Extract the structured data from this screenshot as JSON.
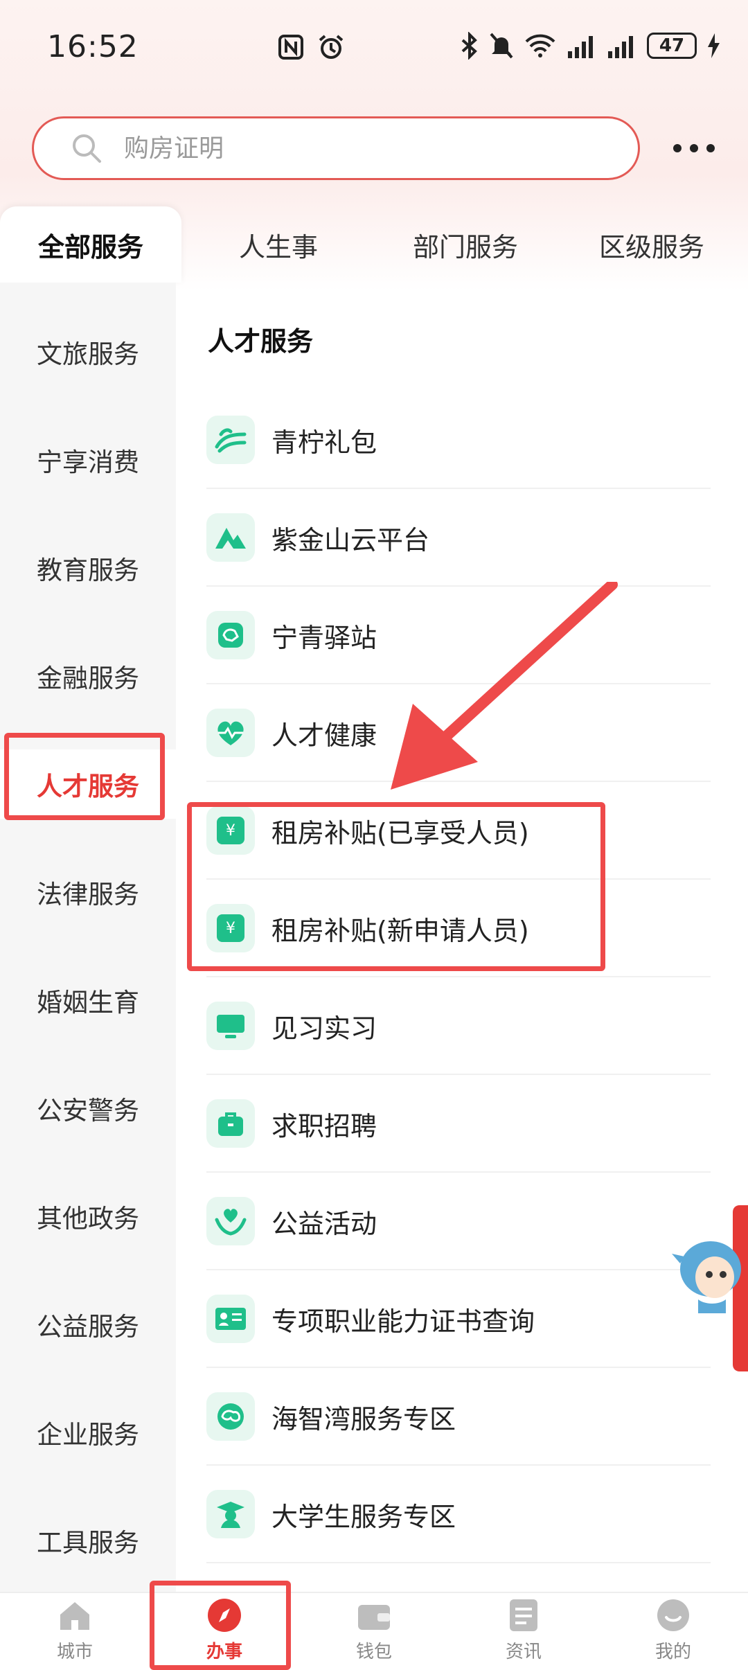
{
  "status_bar": {
    "time": "16:52",
    "battery": "47"
  },
  "search": {
    "placeholder": "购房证明"
  },
  "tabs": [
    {
      "label": "全部服务"
    },
    {
      "label": "人生事"
    },
    {
      "label": "部门服务"
    },
    {
      "label": "区级服务"
    }
  ],
  "side_nav": [
    {
      "label": "文旅服务"
    },
    {
      "label": "宁享消费"
    },
    {
      "label": "教育服务"
    },
    {
      "label": "金融服务"
    },
    {
      "label": "人才服务"
    },
    {
      "label": "法律服务"
    },
    {
      "label": "婚姻生育"
    },
    {
      "label": "公安警务"
    },
    {
      "label": "其他政务"
    },
    {
      "label": "公益服务"
    },
    {
      "label": "企业服务"
    },
    {
      "label": "工具服务"
    }
  ],
  "section": {
    "title": "人才服务"
  },
  "services": [
    {
      "label": "青柠礼包",
      "icon": "lime-gift-icon"
    },
    {
      "label": "紫金山云平台",
      "icon": "mountain-icon"
    },
    {
      "label": "宁青驿站",
      "icon": "station-icon"
    },
    {
      "label": "人才健康",
      "icon": "heart-pulse-icon"
    },
    {
      "label": "租房补贴(已享受人员)",
      "icon": "subsidy-ticket-icon"
    },
    {
      "label": "租房补贴(新申请人员)",
      "icon": "subsidy-ticket-icon"
    },
    {
      "label": "见习实习",
      "icon": "monitor-icon"
    },
    {
      "label": "求职招聘",
      "icon": "briefcase-icon"
    },
    {
      "label": "公益活动",
      "icon": "hands-heart-icon"
    },
    {
      "label": "专项职业能力证书查询",
      "icon": "certificate-icon"
    },
    {
      "label": "海智湾服务专区",
      "icon": "brain-icon"
    },
    {
      "label": "大学生服务专区",
      "icon": "graduate-icon"
    }
  ],
  "bottom_nav": [
    {
      "label": "城市"
    },
    {
      "label": "办事"
    },
    {
      "label": "钱包"
    },
    {
      "label": "资讯"
    },
    {
      "label": "我的"
    }
  ],
  "colors": {
    "accent": "#e53935",
    "icon_green": "#1fbf8a",
    "highlight_box": "#ee4a4a"
  }
}
